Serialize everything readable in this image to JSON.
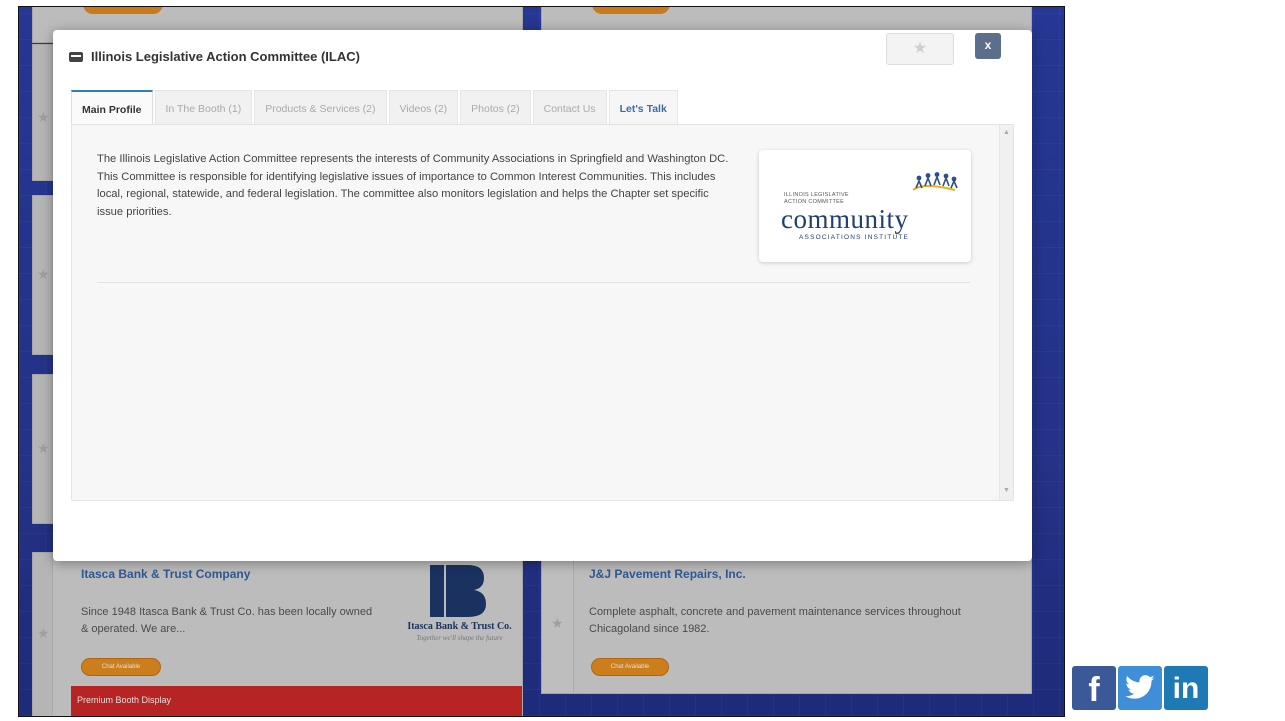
{
  "modal": {
    "title": "Illinois Legislative Action Committee (ILAC)",
    "close_label": "x",
    "favorite_icon": "star-icon",
    "tabs": [
      {
        "label": "Main Profile"
      },
      {
        "label": "In The Booth (1)"
      },
      {
        "label": "Products & Services (2)"
      },
      {
        "label": "Videos (2)"
      },
      {
        "label": "Photos (2)"
      },
      {
        "label": "Contact Us"
      },
      {
        "label": "Let's Talk"
      }
    ],
    "description": "The Illinois Legislative Action Committee represents the interests of Community Associations in Springfield and Washington DC. This Committee is responsible for identifying legislative issues of importance to Common Interest Communities. This includes local, regional, statewide, and federal legislation. The committee also monitors legislation and helps the Chapter set specific issue priorities.",
    "logo": {
      "small_line1": "ILLINOIS LEGISLATIVE",
      "small_line2": "ACTION COMMITTEE",
      "word": "community",
      "sub": "ASSOCIATIONS INSTITUTE"
    }
  },
  "cards": [
    {
      "title": "Itasca Bank & Trust Company",
      "text": "Since 1948 Itasca Bank & Trust Co. has been locally owned & operated. We are...",
      "chat_label": "Chat Available",
      "logo_name": "Itasca Bank & Trust Co.",
      "logo_tagline": "Together we'll shape the future"
    },
    {
      "title": "J&J Pavement Repairs, Inc.",
      "text": "Complete asphalt, concrete and pavement maintenance services throughout Chicagoland since 1982.",
      "chat_label": "Chat Available"
    }
  ],
  "premium_label": "Premium Booth Display",
  "social": {
    "facebook": "f",
    "twitter": "t",
    "linkedin": "in"
  },
  "colors": {
    "accent_blue": "#3765a8",
    "orange": "#e8901f",
    "premium_red": "#d12a2a",
    "facebook": "#3b5998",
    "twitter": "#3f8fd8",
    "linkedin": "#1f79b5"
  }
}
